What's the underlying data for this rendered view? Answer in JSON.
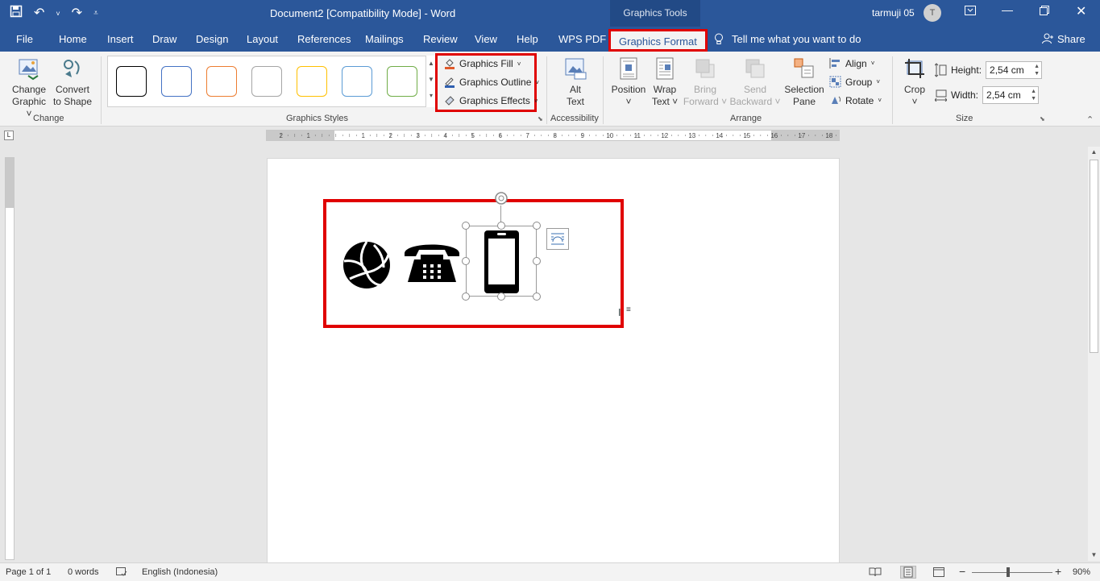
{
  "window": {
    "title": "Document2 [Compatibility Mode]  -  Word",
    "context_tab": "Graphics Tools",
    "user_name": "tarmuji 05",
    "user_initial": "T"
  },
  "menu": {
    "tabs": [
      "File",
      "Home",
      "Insert",
      "Draw",
      "Design",
      "Layout",
      "References",
      "Mailings",
      "Review",
      "View",
      "Help",
      "WPS PDF"
    ],
    "active_tab": "Graphics Format",
    "tell_me": "Tell me what you want to do",
    "share": "Share"
  },
  "ribbon": {
    "change": {
      "change_graphic": [
        "Change",
        "Graphic ˅"
      ],
      "convert_to_shape": [
        "Convert",
        "to Shape"
      ],
      "label": "Change"
    },
    "styles": {
      "label": "Graphics Styles",
      "swatch_colors": [
        "#000000",
        "#4472c4",
        "#ed7d31",
        "#a5a5a5",
        "#ffc000",
        "#5b9bd5",
        "#70ad47"
      ],
      "fill": "Graphics Fill",
      "outline": "Graphics Outline",
      "effects": "Graphics Effects"
    },
    "accessibility": {
      "alt_text": [
        "Alt",
        "Text"
      ],
      "label": "Accessibility"
    },
    "arrange": {
      "position": [
        "Position",
        "˅"
      ],
      "wrap_text": [
        "Wrap",
        "Text ˅"
      ],
      "bring_forward": [
        "Bring",
        "Forward ˅"
      ],
      "send_backward": [
        "Send",
        "Backward ˅"
      ],
      "selection_pane": [
        "Selection",
        "Pane"
      ],
      "align": "Align",
      "group": "Group",
      "rotate": "Rotate",
      "label": "Arrange"
    },
    "size": {
      "crop": [
        "Crop",
        "˅"
      ],
      "height_label": "Height:",
      "height_value": "2,54 cm",
      "width_label": "Width:",
      "width_value": "2,54 cm",
      "label": "Size"
    }
  },
  "ruler": {
    "numbers": [
      "2",
      "1",
      "1",
      "2",
      "3",
      "4",
      "5",
      "6",
      "7",
      "8",
      "9",
      "10",
      "11",
      "12",
      "13",
      "14",
      "15",
      "16",
      "17",
      "18"
    ]
  },
  "document": {
    "icons": [
      "volleyball-icon",
      "telephone-icon",
      "mobile-phone-icon"
    ]
  },
  "status": {
    "page": "Page 1 of 1",
    "words": "0 words",
    "language": "English (Indonesia)",
    "zoom": "90%"
  }
}
